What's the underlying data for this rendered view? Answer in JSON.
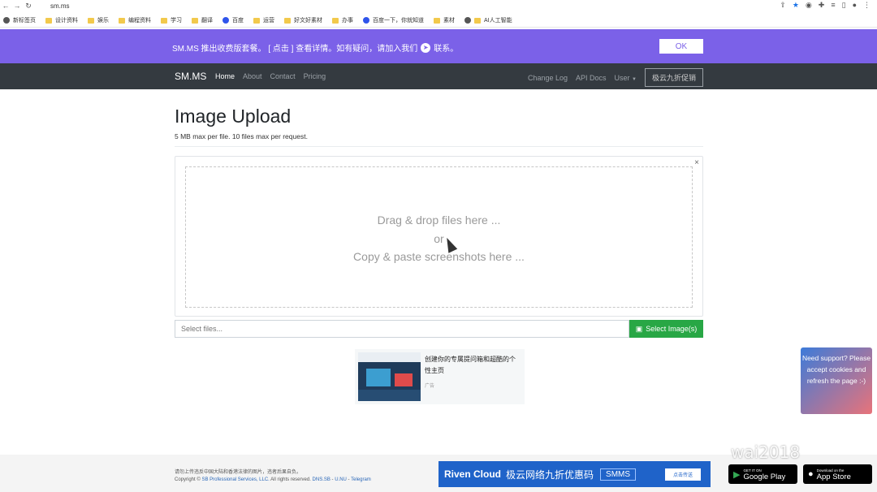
{
  "browser": {
    "url": "sm.ms",
    "bookmarks": [
      "新标签页",
      "设计资料",
      "娱乐",
      "编程资料",
      "学习",
      "翻译",
      "百度",
      "运营",
      "好文好素材",
      "办事",
      "百度一下，你就知道",
      "素材",
      "AI人工智能"
    ]
  },
  "banner": {
    "text": "SM.MS 推出收费版套餐。 [ 点击 ] 查看详情。如有疑问，请加入我们",
    "suffix": "联系。",
    "ok_label": "OK",
    "bg_color": "#7b61e8"
  },
  "navbar": {
    "brand": "SM.MS",
    "links": [
      "Home",
      "About",
      "Contact",
      "Pricing"
    ],
    "right_links": [
      "Change Log",
      "API Docs",
      "User"
    ],
    "promo_label": "极云九折促销"
  },
  "main": {
    "title": "Image Upload",
    "subtitle": "5 MB max per file. 10 files max per request.",
    "dropzone": {
      "line1": "Drag & drop files here ...",
      "line2": "or",
      "line3": "Copy & paste screenshots here ..."
    },
    "file_placeholder": "Select files...",
    "select_button": "Select Image(s)",
    "accent_color": "#28a745"
  },
  "ad": {
    "title": "创建你的专属提问箱和超酷的个性主页",
    "label": "广告"
  },
  "support": {
    "text": "Need support? Please accept cookies and refresh the page :-)"
  },
  "footer": {
    "notice": "请勿上传违反中国大陆和香港法律的图片，违者后果自负。",
    "copyright_prefix": "Copyright ©",
    "company": "SB Professional Services, LLC.",
    "rights": "All rights reserved.",
    "links": [
      "DNS.SB",
      "U.NU",
      "Telegram"
    ],
    "ad_brand": "Riven Cloud",
    "ad_slogan": "极云网络九折优惠码",
    "ad_code": "SMMS",
    "ad_cta": "点击传送",
    "google_play_small": "GET IT ON",
    "google_play_big": "Google Play",
    "app_store_small": "Download on the",
    "app_store_big": "App Store"
  },
  "watermark": "wai2018"
}
